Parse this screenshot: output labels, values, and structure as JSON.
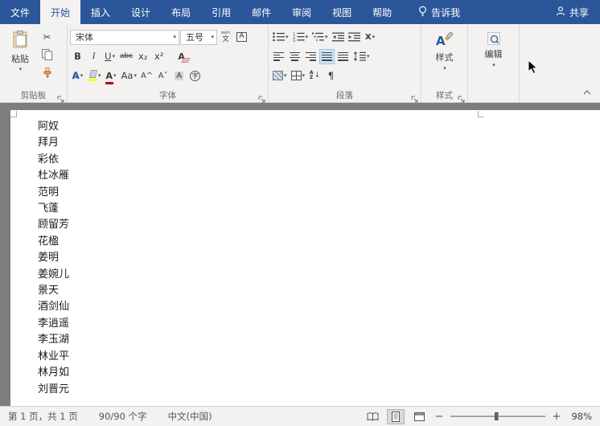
{
  "titlebar": {
    "tabs": [
      {
        "label": "文件"
      },
      {
        "label": "开始"
      },
      {
        "label": "插入"
      },
      {
        "label": "设计"
      },
      {
        "label": "布局"
      },
      {
        "label": "引用"
      },
      {
        "label": "邮件"
      },
      {
        "label": "审阅"
      },
      {
        "label": "视图"
      },
      {
        "label": "帮助"
      }
    ],
    "tell_me_label": "告诉我",
    "share_label": "共享"
  },
  "ribbon": {
    "clipboard": {
      "paste_label": "粘贴",
      "group_label": "剪贴板"
    },
    "font": {
      "name_value": "宋体",
      "size_value": "五号",
      "group_label": "字体"
    },
    "paragraph": {
      "group_label": "段落"
    },
    "styles": {
      "button_label": "样式",
      "group_label": "样式"
    },
    "editing": {
      "button_label": "编辑"
    }
  },
  "icons": {
    "caret": "▾",
    "cut": "✂",
    "bold": "B",
    "italic": "I",
    "underline": "U",
    "strikethrough": "abc",
    "subscript": "x₂",
    "superscript": "x²",
    "clear_format": "A",
    "text_effects": "A",
    "font_color": "A",
    "change_case": "Aa",
    "grow_font": "A^",
    "shrink_font": "Aˇ",
    "char_shading": "A",
    "enclose_char": "字",
    "phonetic_top": "wén",
    "phonetic_bottom": "文",
    "char_border": "A",
    "asian_layout": "X",
    "sort_a": "A",
    "sort_z": "Z",
    "sort_arrow": "↓",
    "pilcrow": "¶",
    "styles_letter": "A"
  },
  "document": {
    "names": [
      "阿奴",
      "拜月",
      "彩依",
      "杜冰雁",
      "范明",
      "飞蓬",
      "顾留芳",
      "花楹",
      "姜明",
      "姜婉儿",
      "景天",
      "酒剑仙",
      "李逍遥",
      "李玉湖",
      "林业平",
      "林月如",
      "刘晋元"
    ]
  },
  "statusbar": {
    "page_info": "第 1 页，共 1 页",
    "word_count": "90/90 个字",
    "language": "中文(中国)",
    "zoom_out": "−",
    "zoom_in": "+",
    "zoom_level": "98%"
  },
  "colors": {
    "accent": "#2b579a",
    "doc_bg": "#7d7d7d",
    "highlight_yellow": "#ffff00",
    "font_color_red": "#c00000"
  }
}
